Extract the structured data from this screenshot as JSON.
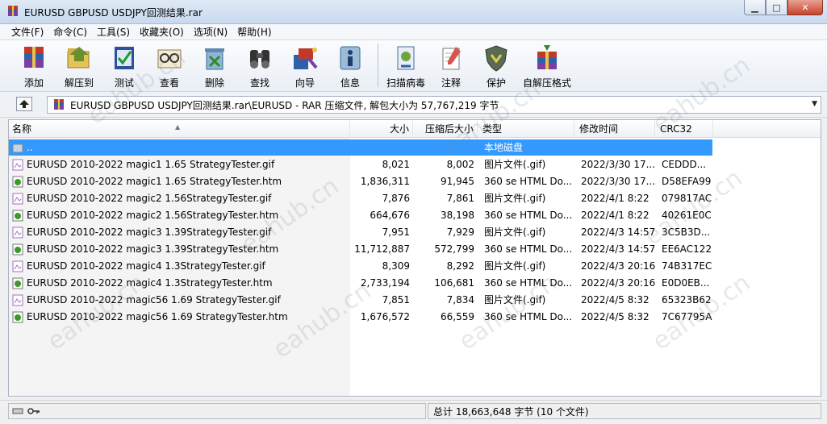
{
  "window": {
    "title": "EURUSD GBPUSD USDJPY回测结果.rar",
    "minimize": "▁",
    "maximize": "□",
    "close": "✕"
  },
  "menu": [
    "文件(F)",
    "命令(C)",
    "工具(S)",
    "收藏夹(O)",
    "选项(N)",
    "帮助(H)"
  ],
  "toolbar": {
    "group1": [
      {
        "label": "添加",
        "icon": "add-archive-icon"
      },
      {
        "label": "解压到",
        "icon": "extract-to-icon"
      },
      {
        "label": "测试",
        "icon": "test-icon"
      },
      {
        "label": "查看",
        "icon": "view-icon"
      },
      {
        "label": "删除",
        "icon": "delete-icon"
      },
      {
        "label": "查找",
        "icon": "find-icon"
      },
      {
        "label": "向导",
        "icon": "wizard-icon"
      },
      {
        "label": "信息",
        "icon": "info-icon"
      }
    ],
    "group2": [
      {
        "label": "扫描病毒",
        "icon": "virus-scan-icon"
      },
      {
        "label": "注释",
        "icon": "comment-icon"
      },
      {
        "label": "保护",
        "icon": "protect-icon"
      },
      {
        "label": "自解压格式",
        "icon": "sfx-icon"
      }
    ]
  },
  "address": {
    "path": "EURUSD GBPUSD USDJPY回测结果.rar\\EURUSD - RAR 压缩文件, 解包大小为 57,767,219 字节"
  },
  "columns": {
    "name": "名称",
    "size": "大小",
    "packed": "压缩后大小",
    "type": "类型",
    "modified": "修改时间",
    "crc": "CRC32"
  },
  "rows": [
    {
      "name": "..",
      "size": "",
      "packed": "",
      "type": "本地磁盘",
      "modified": "",
      "crc": "",
      "kind": "folder"
    },
    {
      "name": "EURUSD 2010-2022 magic1 1.65 StrategyTester.gif",
      "size": "8,021",
      "packed": "8,002",
      "type": "图片文件(.gif)",
      "modified": "2022/3/30 17...",
      "crc": "CEDDD...",
      "kind": "gif"
    },
    {
      "name": "EURUSD 2010-2022 magic1 1.65 StrategyTester.htm",
      "size": "1,836,311",
      "packed": "91,945",
      "type": "360 se HTML Do...",
      "modified": "2022/3/30 17...",
      "crc": "D58EFA99",
      "kind": "htm"
    },
    {
      "name": "EURUSD 2010-2022 magic2 1.56StrategyTester.gif",
      "size": "7,876",
      "packed": "7,861",
      "type": "图片文件(.gif)",
      "modified": "2022/4/1 8:22",
      "crc": "079817AC",
      "kind": "gif"
    },
    {
      "name": "EURUSD 2010-2022 magic2 1.56StrategyTester.htm",
      "size": "664,676",
      "packed": "38,198",
      "type": "360 se HTML Do...",
      "modified": "2022/4/1 8:22",
      "crc": "40261E0C",
      "kind": "htm"
    },
    {
      "name": "EURUSD 2010-2022 magic3 1.39StrategyTester.gif",
      "size": "7,951",
      "packed": "7,929",
      "type": "图片文件(.gif)",
      "modified": "2022/4/3 14:57",
      "crc": "3C5B3D...",
      "kind": "gif"
    },
    {
      "name": "EURUSD 2010-2022 magic3 1.39StrategyTester.htm",
      "size": "11,712,887",
      "packed": "572,799",
      "type": "360 se HTML Do...",
      "modified": "2022/4/3 14:57",
      "crc": "EE6AC122",
      "kind": "htm"
    },
    {
      "name": "EURUSD 2010-2022 magic4 1.3StrategyTester.gif",
      "size": "8,309",
      "packed": "8,292",
      "type": "图片文件(.gif)",
      "modified": "2022/4/3 20:16",
      "crc": "74B317EC",
      "kind": "gif"
    },
    {
      "name": "EURUSD 2010-2022 magic4 1.3StrategyTester.htm",
      "size": "2,733,194",
      "packed": "106,681",
      "type": "360 se HTML Do...",
      "modified": "2022/4/3 20:16",
      "crc": "E0D0EB...",
      "kind": "htm"
    },
    {
      "name": "EURUSD 2010-2022 magic56 1.69 StrategyTester.gif",
      "size": "7,851",
      "packed": "7,834",
      "type": "图片文件(.gif)",
      "modified": "2022/4/5 8:32",
      "crc": "65323B62",
      "kind": "gif"
    },
    {
      "name": "EURUSD 2010-2022 magic56 1.69 StrategyTester.htm",
      "size": "1,676,572",
      "packed": "66,559",
      "type": "360 se HTML Do...",
      "modified": "2022/4/5 8:32",
      "crc": "7C67795A",
      "kind": "htm"
    }
  ],
  "status": {
    "summary": "总计 18,663,648 字节 (10 个文件)"
  },
  "watermark": "eahub.cn",
  "colors": {
    "selection": "#3399ff",
    "htm_icon": "#3c9a2c",
    "gif_icon": "#a66fc0"
  }
}
